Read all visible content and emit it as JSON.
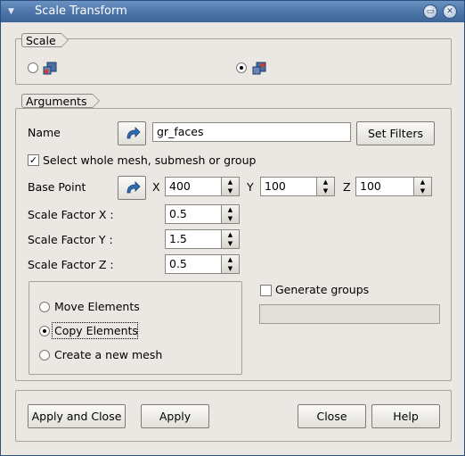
{
  "window": {
    "title": "Scale Transform",
    "menu_icon": "window-menu-icon"
  },
  "scale_group": {
    "title": "Scale",
    "option1": {
      "selected": false,
      "icon": "node-mesh-icon"
    },
    "option2": {
      "selected": true,
      "icon": "element-mesh-icon"
    }
  },
  "arguments": {
    "title": "Arguments",
    "name_label": "Name",
    "name_value": "gr_faces",
    "set_filters": "Set Filters",
    "select_whole_mesh": "Select whole mesh, submesh or group",
    "select_whole_mesh_checked": true,
    "base_point_label": "Base Point",
    "x_label": "X",
    "x_value": "400",
    "y_label": "Y",
    "y_value": "100",
    "z_label": "Z",
    "z_value": "100",
    "scale_x_label": "Scale Factor X :",
    "scale_x_value": "0.5",
    "scale_y_label": "Scale Factor Y :",
    "scale_y_value": "1.5",
    "scale_z_label": "Scale Factor Z :",
    "scale_z_value": "0.5",
    "options": [
      {
        "label": "Move Elements",
        "selected": false
      },
      {
        "label": "Copy Elements",
        "selected": true
      },
      {
        "label": "Create a new mesh",
        "selected": false
      }
    ],
    "generate_groups": "Generate groups",
    "generate_groups_checked": false
  },
  "buttons": {
    "apply_close": "Apply and Close",
    "apply": "Apply",
    "close": "Close",
    "help": "Help"
  }
}
